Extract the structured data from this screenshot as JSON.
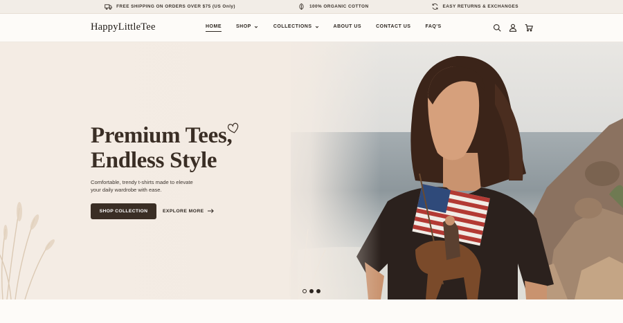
{
  "announcement": {
    "items": [
      {
        "icon": "truck-icon",
        "text": "FREE SHIPPING ON ORDERS OVER $75 (US Only)"
      },
      {
        "icon": "leaf-icon",
        "text": "100% ORGANIC COTTON"
      },
      {
        "icon": "refresh-icon",
        "text": "EASY RETURNS & EXCHANGES"
      }
    ]
  },
  "header": {
    "logo": "HappyLittleTee",
    "nav": [
      {
        "label": "HOME",
        "active": true,
        "dropdown": false
      },
      {
        "label": "SHOP",
        "active": false,
        "dropdown": true
      },
      {
        "label": "COLLECTIONS",
        "active": false,
        "dropdown": true
      },
      {
        "label": "ABOUT US",
        "active": false,
        "dropdown": false
      },
      {
        "label": "CONTACT US",
        "active": false,
        "dropdown": false
      },
      {
        "label": "FAQ'S",
        "active": false,
        "dropdown": false
      }
    ],
    "icons": [
      "search-icon",
      "user-icon",
      "cart-icon"
    ]
  },
  "hero": {
    "title_line1": "Premium Tees,",
    "title_line2": "Endless Style",
    "subtitle": "Comfortable, trendy t-shirts made to elevate your daily wardrobe with ease.",
    "primary_button": "SHOP COLLECTION",
    "secondary_link": "EXPLORE MORE",
    "slides": {
      "count": 3,
      "active_index": 0
    }
  },
  "colors": {
    "accent": "#3a2e25",
    "hero_bg": "#f3ebe3",
    "announcement_bg": "#f2ede7",
    "page_bg": "#fdfbf8"
  }
}
